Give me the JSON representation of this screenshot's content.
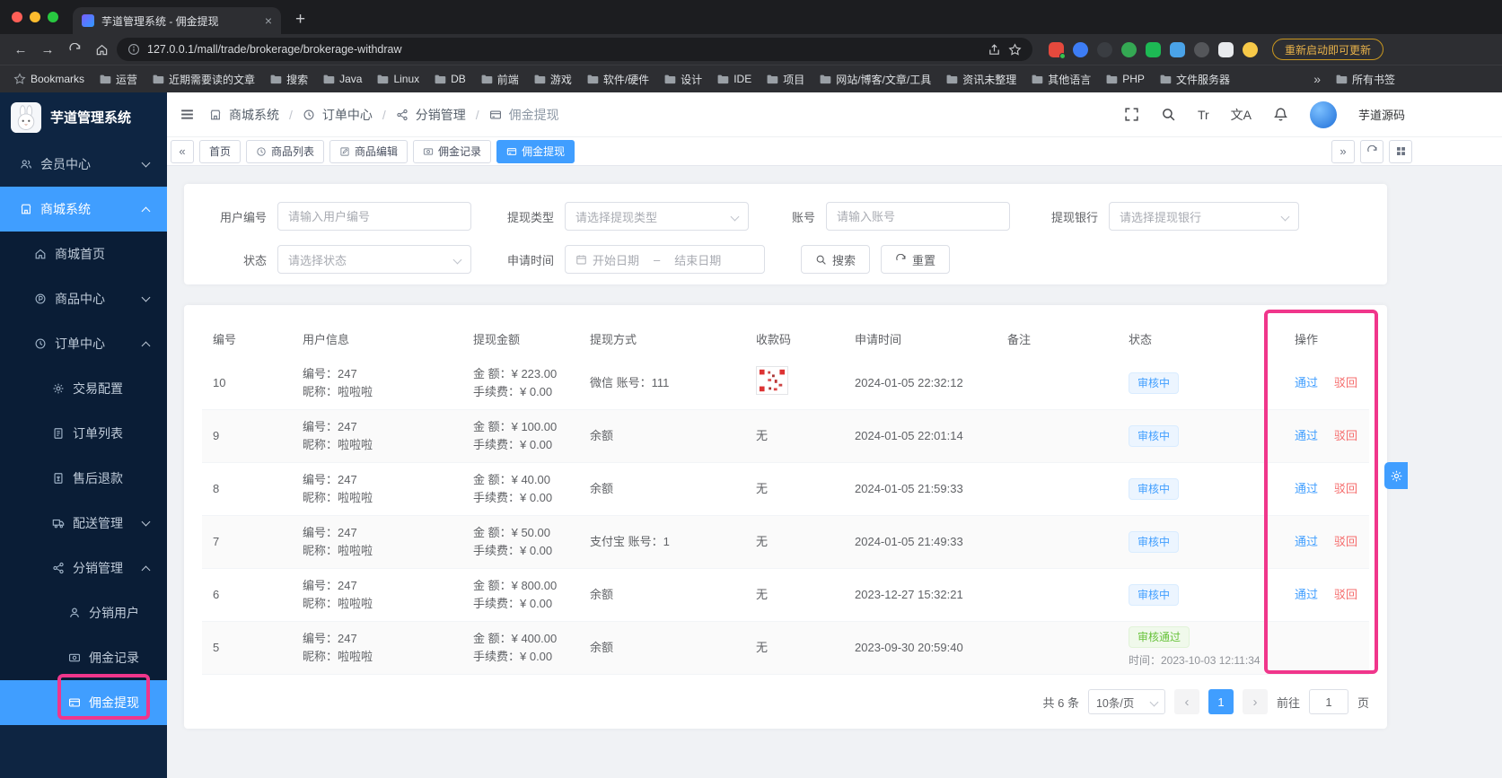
{
  "glyphs": {
    "back": "←",
    "forward": "→",
    "plus": "+",
    "close": "×",
    "tabs_prev": "«",
    "tabs_next": "»",
    "page_prev": "‹",
    "page_next": "›",
    "separator": "/",
    "dash": "–"
  },
  "browser": {
    "tab_title": "芋道管理系统 - 佣金提现",
    "url": "127.0.0.1/mall/trade/brokerage/brokerage-withdraw",
    "update_button": "重新启动即可更新",
    "bookmarks_label": "Bookmarks",
    "bookmarks": [
      "运营",
      "近期需要读的文章",
      "搜索",
      "Java",
      "Linux",
      "DB",
      "前端",
      "游戏",
      "软件/硬件",
      "设计",
      "IDE",
      "项目",
      "网站/博客/文章/工具",
      "资讯未整理",
      "其他语言",
      "PHP",
      "文件服务器"
    ],
    "bookmarks_overflow": "»",
    "all_bookmarks": "所有书签"
  },
  "sidebar": {
    "logo_title": "芋道管理系统",
    "items": [
      {
        "label": "会员中心"
      },
      {
        "label": "商城系统"
      },
      {
        "label": "商城首页"
      },
      {
        "label": "商品中心"
      },
      {
        "label": "订单中心"
      },
      {
        "label": "交易配置"
      },
      {
        "label": "订单列表"
      },
      {
        "label": "售后退款"
      },
      {
        "label": "配送管理"
      },
      {
        "label": "分销管理"
      },
      {
        "label": "分销用户"
      },
      {
        "label": "佣金记录"
      },
      {
        "label": "佣金提现"
      }
    ]
  },
  "header": {
    "breadcrumb": [
      "商城系统",
      "订单中心",
      "分销管理",
      "佣金提现"
    ],
    "font_icon_text": "Tr",
    "lang_icon_text": "文A",
    "username": "芋道源码"
  },
  "tabs": [
    "首页",
    "商品列表",
    "商品编辑",
    "佣金记录",
    "佣金提现"
  ],
  "filters": {
    "user_no_label": "用户编号",
    "user_no_placeholder": "请输入用户编号",
    "type_label": "提现类型",
    "type_placeholder": "请选择提现类型",
    "account_label": "账号",
    "account_placeholder": "请输入账号",
    "bank_label": "提现银行",
    "bank_placeholder": "请选择提现银行",
    "status_label": "状态",
    "status_placeholder": "请选择状态",
    "time_label": "申请时间",
    "time_start": "开始日期",
    "time_end": "结束日期",
    "search_button": "搜索",
    "reset_button": "重置"
  },
  "table": {
    "headers": [
      "编号",
      "用户信息",
      "提现金额",
      "提现方式",
      "收款码",
      "申请时间",
      "备注",
      "状态",
      "操作"
    ],
    "pass_action": "通过",
    "reject_action": "驳回",
    "rows": [
      {
        "id": "10",
        "user_no": "编号：247",
        "nickname": "昵称：啦啦啦",
        "amount": "金 额：¥ 223.00",
        "fee": "手续费：¥ 0.00",
        "method": "微信 账号：111",
        "code": "",
        "time": "2024-01-05 22:32:12",
        "remark": "",
        "status": "审核中"
      },
      {
        "id": "9",
        "user_no": "编号：247",
        "nickname": "昵称：啦啦啦",
        "amount": "金 额：¥ 100.00",
        "fee": "手续费：¥ 0.00",
        "method": "余额",
        "code": "无",
        "time": "2024-01-05 22:01:14",
        "remark": "",
        "status": "审核中"
      },
      {
        "id": "8",
        "user_no": "编号：247",
        "nickname": "昵称：啦啦啦",
        "amount": "金 额：¥ 40.00",
        "fee": "手续费：¥ 0.00",
        "method": "余额",
        "code": "无",
        "time": "2024-01-05 21:59:33",
        "remark": "",
        "status": "审核中"
      },
      {
        "id": "7",
        "user_no": "编号：247",
        "nickname": "昵称：啦啦啦",
        "amount": "金 额：¥ 50.00",
        "fee": "手续费：¥ 0.00",
        "method": "支付宝 账号：1",
        "code": "无",
        "time": "2024-01-05 21:49:33",
        "remark": "",
        "status": "审核中"
      },
      {
        "id": "6",
        "user_no": "编号：247",
        "nickname": "昵称：啦啦啦",
        "amount": "金 额：¥ 800.00",
        "fee": "手续费：¥ 0.00",
        "method": "余额",
        "code": "无",
        "time": "2023-12-27 15:32:21",
        "remark": "",
        "status": "审核中"
      },
      {
        "id": "5",
        "user_no": "编号：247",
        "nickname": "昵称：啦啦啦",
        "amount": "金 额：¥ 400.00",
        "fee": "手续费：¥ 0.00",
        "method": "余额",
        "code": "无",
        "time": "2023-09-30 20:59:40",
        "remark": "",
        "status": "审核通过",
        "status_time": "时间：2023-10-03 12:11:34"
      }
    ]
  },
  "pagination": {
    "total": "共 6 条",
    "page_size": "10条/页",
    "current_page": "1",
    "goto_label": "前往",
    "goto_value": "1",
    "page_unit": "页"
  }
}
